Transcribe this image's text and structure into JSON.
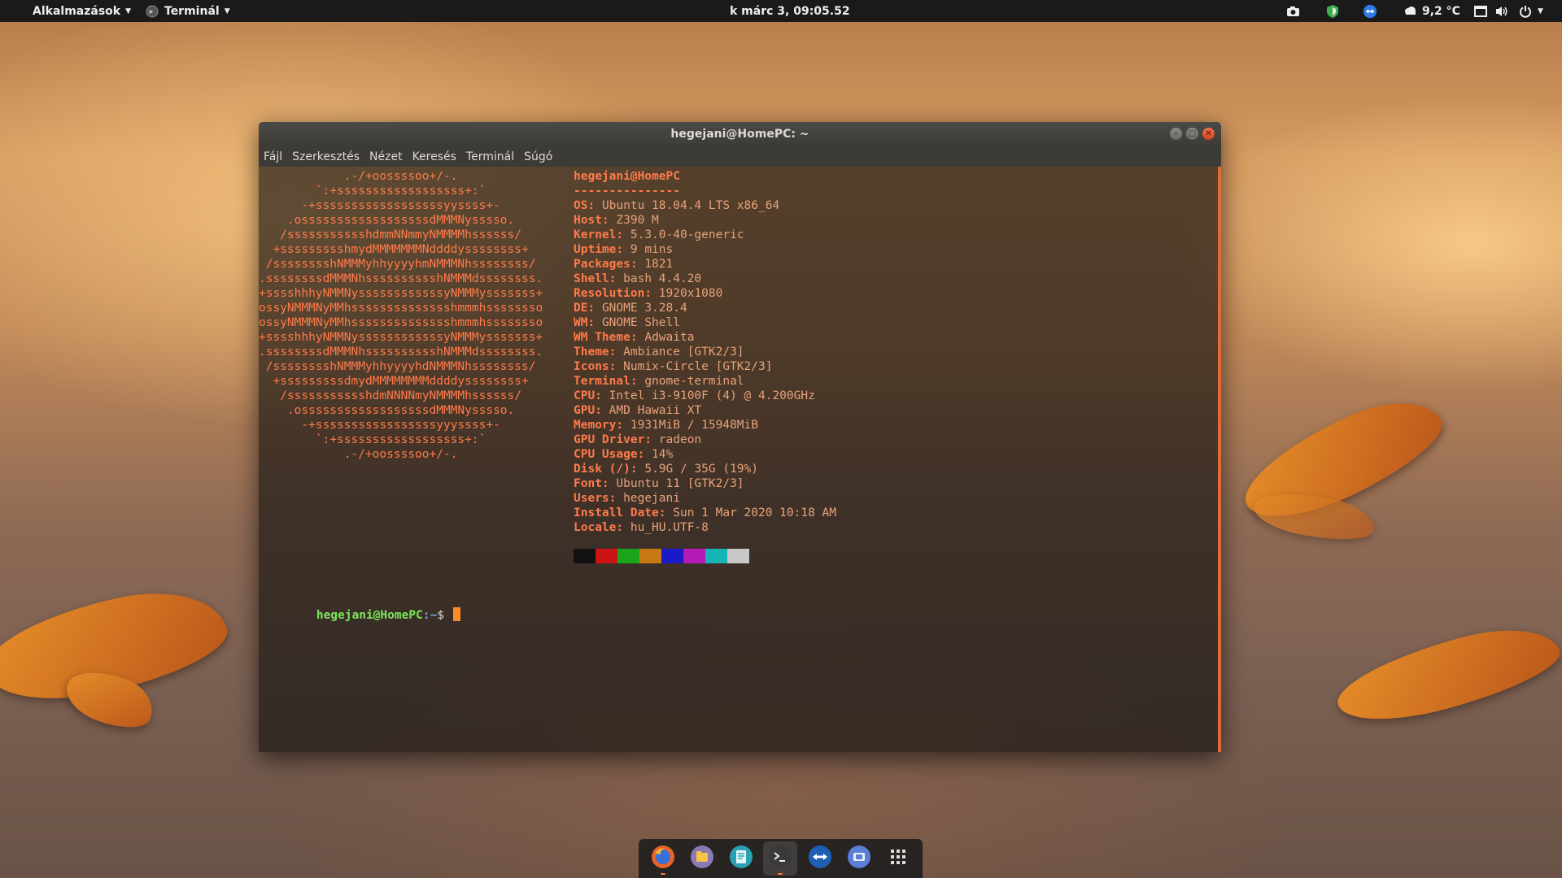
{
  "topbar": {
    "activities_label": "Alkalmazások",
    "app_menu_label": "Terminál",
    "clock": "k márc  3, 09:05.52",
    "weather": "9,2 °C"
  },
  "window": {
    "title": "hegejani@HomePC: ~",
    "menu": [
      "Fájl",
      "Szerkesztés",
      "Nézet",
      "Keresés",
      "Terminál",
      "Súgó"
    ]
  },
  "neofetch": {
    "logo_lines": [
      "            .-/+oossssoo+/-.",
      "        `:+ssssssssssssssssss+:`",
      "      -+ssssssssssssssssssyyssss+-",
      "    .ossssssssssssssssssdMMMNysssso.",
      "   /ssssssssssshdmmNNmmyNMMMMhssssss/",
      "  +ssssssssshmydMMMMMMMNddddyssssssss+",
      " /sssssssshNMMMyhhyyyyhmNMMMNhssssssss/",
      ".ssssssssdMMMNhsssssssssshNMMMdssssssss.",
      "+sssshhhyNMMNyssssssssssssyNMMMysssssss+",
      "ossyNMMMNyMMhsssssssssssssshmmmhssssssso",
      "ossyNMMMNyMMhsssssssssssssshmmmhssssssso",
      "+sssshhhyNMMNyssssssssssssyNMMMysssssss+",
      ".ssssssssdMMMNhsssssssssshNMMMdssssssss.",
      " /sssssssshNMMMyhhyyyyhdNMMMNhssssssss/",
      "  +sssssssssdmydMMMMMMMMddddyssssssss+",
      "   /ssssssssssshdmNNNNmyNMMMMhssssss/",
      "    .ossssssssssssssssssdMMMNysssso.",
      "      -+sssssssssssssssssyyyssss+-",
      "        `:+ssssssssssssssssss+:`",
      "            .-/+oossssoo+/-."
    ],
    "header": "hegejani@HomePC",
    "separator": "---------------",
    "fields": [
      {
        "key": "OS",
        "value": "Ubuntu 18.04.4 LTS x86_64"
      },
      {
        "key": "Host",
        "value": "Z390 M"
      },
      {
        "key": "Kernel",
        "value": "5.3.0-40-generic"
      },
      {
        "key": "Uptime",
        "value": "9 mins"
      },
      {
        "key": "Packages",
        "value": "1821"
      },
      {
        "key": "Shell",
        "value": "bash 4.4.20"
      },
      {
        "key": "Resolution",
        "value": "1920x1080"
      },
      {
        "key": "DE",
        "value": "GNOME 3.28.4"
      },
      {
        "key": "WM",
        "value": "GNOME Shell"
      },
      {
        "key": "WM Theme",
        "value": "Adwaita"
      },
      {
        "key": "Theme",
        "value": "Ambiance [GTK2/3]"
      },
      {
        "key": "Icons",
        "value": "Numix-Circle [GTK2/3]"
      },
      {
        "key": "Terminal",
        "value": "gnome-terminal"
      },
      {
        "key": "CPU",
        "value": "Intel i3-9100F (4) @ 4.200GHz"
      },
      {
        "key": "GPU",
        "value": "AMD Hawaii XT"
      },
      {
        "key": "Memory",
        "value": "1931MiB / 15948MiB"
      },
      {
        "key": "GPU Driver",
        "value": "radeon"
      },
      {
        "key": "CPU Usage",
        "value": "14%"
      },
      {
        "key": "Disk (/)",
        "value": "5.9G / 35G (19%)"
      },
      {
        "key": "Font",
        "value": "Ubuntu 11 [GTK2/3]"
      },
      {
        "key": "Users",
        "value": "hegejani"
      },
      {
        "key": "Install Date",
        "value": "Sun 1 Mar 2020 10:18 AM"
      },
      {
        "key": "Locale",
        "value": "hu_HU.UTF-8"
      }
    ],
    "color_blocks": [
      "#111111",
      "#cc1414",
      "#1aa51a",
      "#c87814",
      "#1a1ac8",
      "#b41ab4",
      "#14b4b4",
      "#c8c8c8"
    ]
  },
  "prompt": {
    "user_host": "hegejani@HomePC",
    "path": ":~",
    "symbol": "$ "
  },
  "dock": {
    "items": [
      {
        "name": "firefox-icon",
        "color": "#e8642a",
        "running": true
      },
      {
        "name": "files-icon",
        "color": "#8a7ab4",
        "running": false
      },
      {
        "name": "text-editor-icon",
        "color": "#2aa1b2",
        "running": false
      },
      {
        "name": "terminal-icon",
        "color": "#3a3a3a",
        "running": true
      },
      {
        "name": "teamviewer-icon",
        "color": "#1e5fb4",
        "running": false
      },
      {
        "name": "virtualbox-icon",
        "color": "#5b7fd6",
        "running": false
      },
      {
        "name": "app-grid-icon",
        "color": "#dddddd",
        "running": false
      }
    ]
  }
}
